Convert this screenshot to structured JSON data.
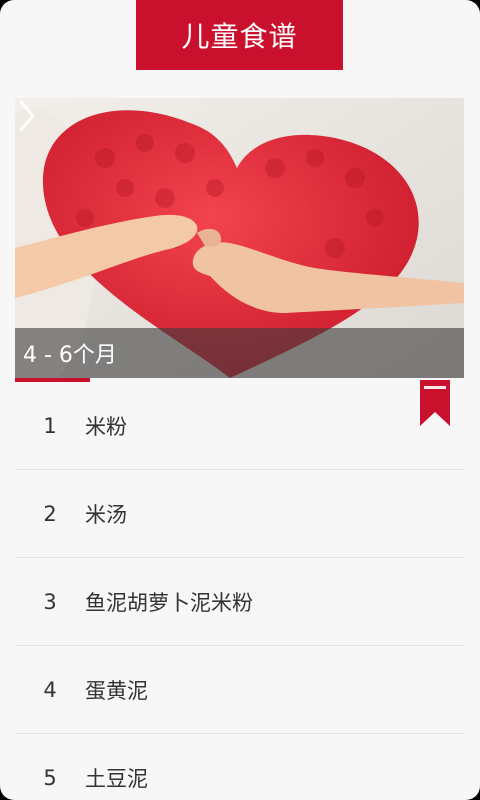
{
  "app": {
    "title": "儿童食谱"
  },
  "banner": {
    "caption": "4 - 6个月"
  },
  "recipes": [
    {
      "index": "1",
      "name": "米粉"
    },
    {
      "index": "2",
      "name": "米汤"
    },
    {
      "index": "3",
      "name": "鱼泥胡萝卜泥米粉"
    },
    {
      "index": "4",
      "name": "蛋黄泥"
    },
    {
      "index": "5",
      "name": "土豆泥"
    }
  ],
  "colors": {
    "accent": "#c9102c",
    "background": "#f7f7f7"
  },
  "icons": {
    "next": "chevron-right-icon",
    "bookmark": "bookmark-icon"
  }
}
